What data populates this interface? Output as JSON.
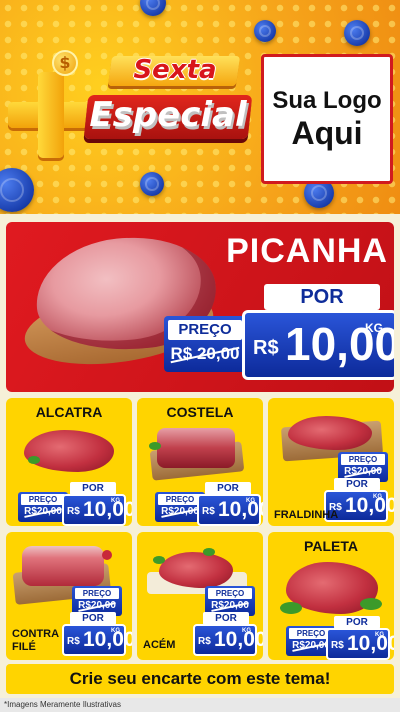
{
  "header": {
    "word1": "Sexta",
    "word2": "Especial",
    "plus_symbol": "+",
    "coin_symbol": "$",
    "logo_line1": "Sua Logo",
    "logo_line2": "Aqui"
  },
  "hero": {
    "product": "PICANHA",
    "por_label": "POR",
    "preco_label": "PREÇO",
    "old_price": "R$ 20,00",
    "currency": "R$",
    "price": "10,00",
    "unit": "KG"
  },
  "products": [
    {
      "name": "ALCATRA",
      "preco_label": "PREÇO",
      "old_price": "R$20,00",
      "por_label": "POR",
      "currency": "R$",
      "price": "10,00",
      "unit": "KG"
    },
    {
      "name": "COSTELA",
      "preco_label": "PREÇO",
      "old_price": "R$20,00",
      "por_label": "POR",
      "currency": "R$",
      "price": "10,00",
      "unit": "KG"
    },
    {
      "name": "FRALDINHA",
      "preco_label": "PREÇO",
      "old_price": "R$20,00",
      "por_label": "POR",
      "currency": "R$",
      "price": "10,00",
      "unit": "KG"
    },
    {
      "name": "CONTRA FILÉ",
      "name_line1": "CONTRA",
      "name_line2": "FILÉ",
      "preco_label": "PREÇO",
      "old_price": "R$20,00",
      "por_label": "POR",
      "currency": "R$",
      "price": "10,00",
      "unit": "KG"
    },
    {
      "name": "ACÉM",
      "preco_label": "PREÇO",
      "old_price": "R$20,00",
      "por_label": "POR",
      "currency": "R$",
      "price": "10,00",
      "unit": "KG"
    },
    {
      "name": "PALETA",
      "preco_label": "PREÇO",
      "old_price": "R$20,00",
      "por_label": "POR",
      "currency": "R$",
      "price": "10,00",
      "unit": "KG"
    }
  ],
  "cta": "Crie seu encarte com este tema!",
  "footer_note": "*Imagens Meramente Ilustrativas",
  "colors": {
    "red": "#d01a1f",
    "yellow": "#ffd400",
    "blue": "#0d2a9a",
    "orange": "#f6a41a"
  }
}
